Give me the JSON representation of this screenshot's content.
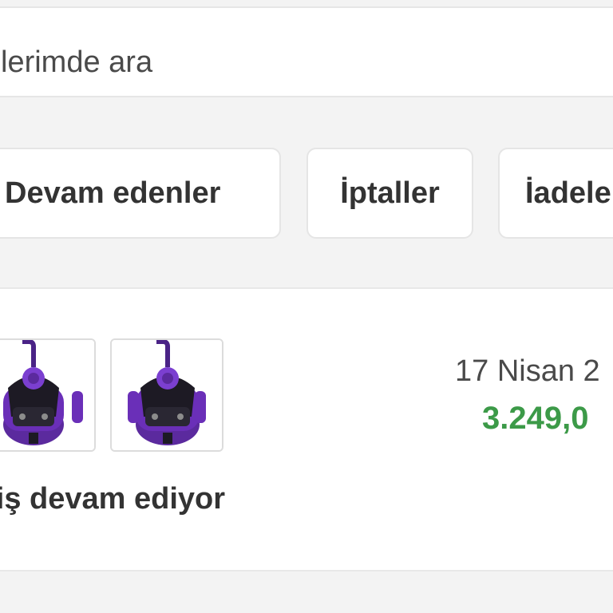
{
  "search": {
    "placeholder": "şlerimde ara"
  },
  "filters": {
    "tabs": [
      {
        "label": "Devam edenler"
      },
      {
        "label": "İptaller"
      },
      {
        "label": "İadele"
      }
    ]
  },
  "order": {
    "date": "17 Nisan 2",
    "price": "3.249,0",
    "status": "riş devam ediyor",
    "products": [
      {
        "image": "purple-vacuum-cleaner"
      },
      {
        "image": "purple-vacuum-cleaner"
      }
    ]
  },
  "colors": {
    "price": "#3c9a48",
    "product_accent": "#6a2fb8"
  }
}
